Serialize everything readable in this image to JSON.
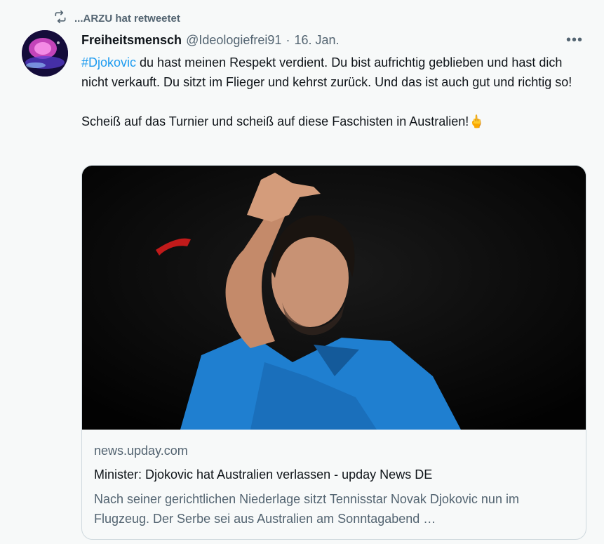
{
  "retweet": {
    "label": "...ARZU hat retweetet"
  },
  "author": {
    "name": "Freiheitsmensch",
    "handle": "@Ideologiefrei91",
    "separator": "·",
    "date": "16. Jan."
  },
  "more_label": "•••",
  "tweet": {
    "hashtag": "#Djokovic",
    "text_1": " du hast meinen Respekt verdient. Du bist aufrichtig geblieben und hast dich nicht verkauft. Du sitzt im Flieger und kehrst zurück. Und das ist auch gut und richtig so!",
    "text_2": "Scheiß auf das Turnier und scheiß auf diese Faschisten in Australien!",
    "emoji": "🖕"
  },
  "card": {
    "domain": "news.upday.com",
    "title": "Minister: Djokovic hat Australien verlassen - upday News DE",
    "description": "Nach seiner gerichtlichen Niederlage sitzt Tennisstar Novak Djokovic nun im Flugzeug. Der Serbe sei aus Australien am Sonntagabend …"
  },
  "colors": {
    "background": "#f7f9f9",
    "hashtag": "#1d9bf0",
    "secondary_text": "#536471",
    "shirt": "#1f7fd0"
  }
}
